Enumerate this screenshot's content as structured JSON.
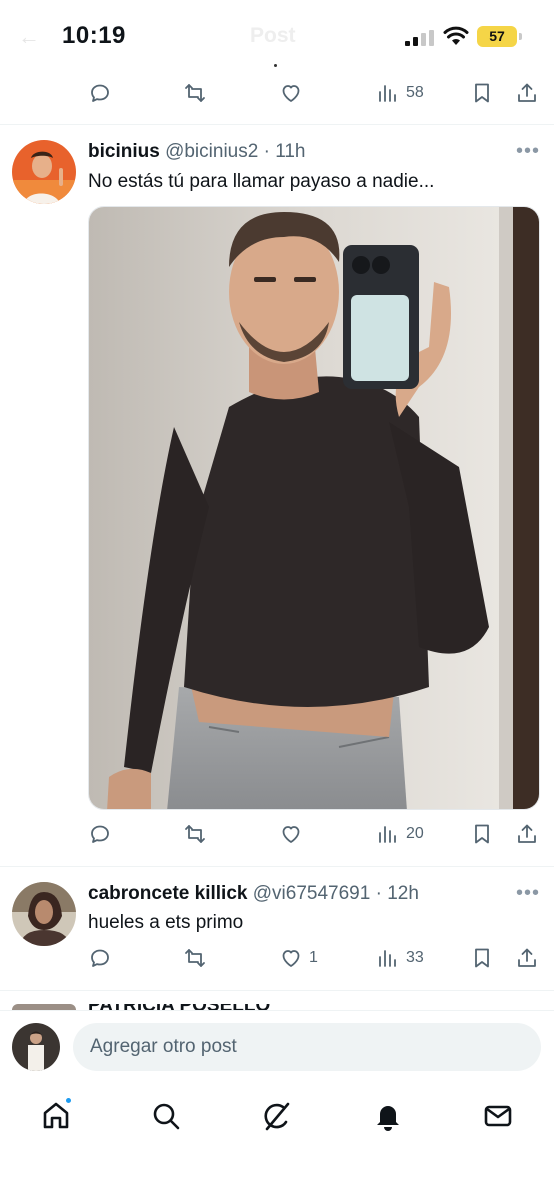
{
  "status_bar": {
    "time": "10:19",
    "battery": "57",
    "faded_title": "Post"
  },
  "top_actions": {
    "views": "58"
  },
  "posts": [
    {
      "name": "bicinius",
      "handle": "@bicinius2",
      "time": "11h",
      "text": "No estás tú para llamar payaso a nadie...",
      "views": "20"
    },
    {
      "name": "cabroncete killick",
      "handle": "@vi67547691",
      "time": "12h",
      "text": "hueles a ets primo",
      "likes": "1",
      "views": "33"
    }
  ],
  "partial_post": {
    "name": "PATRICIA POSELLO"
  },
  "composer": {
    "placeholder": "Agregar otro post"
  },
  "colors": {
    "accent": "#1d9bf0",
    "icon": "#536471",
    "battery": "#f5d547"
  },
  "nav": [
    "home-icon",
    "search-icon",
    "grok-icon",
    "notifications-icon",
    "messages-icon"
  ]
}
